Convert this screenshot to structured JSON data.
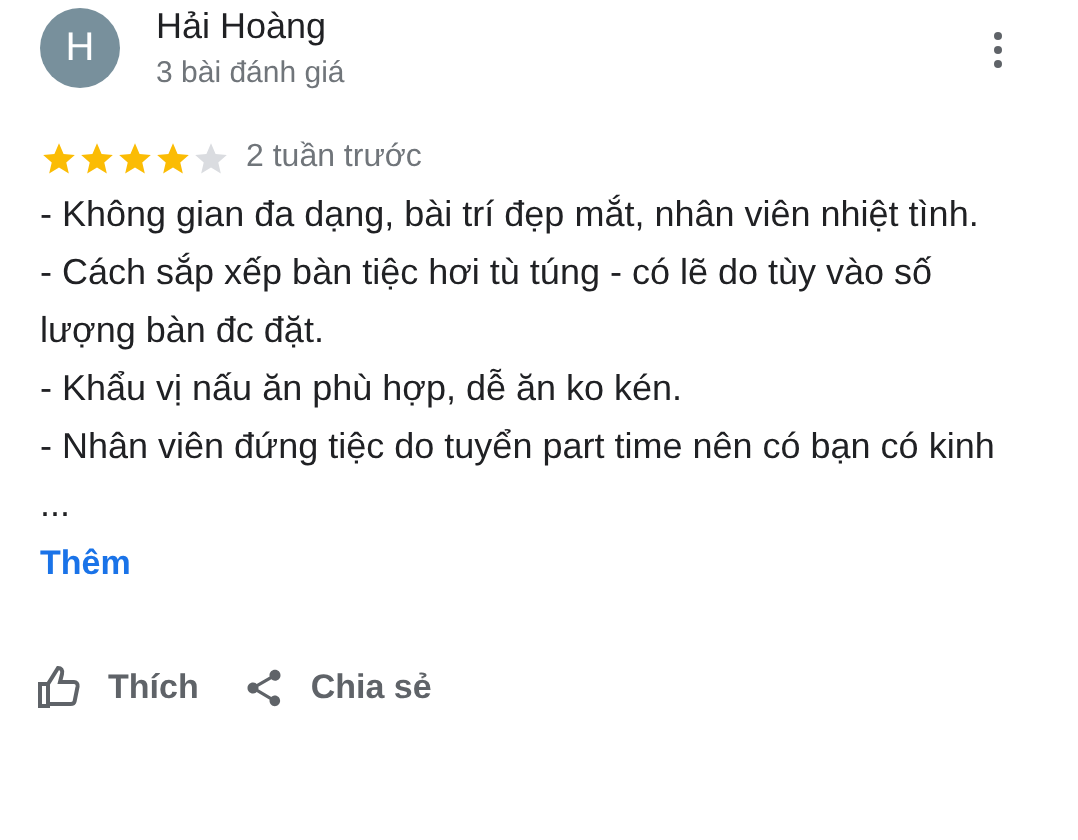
{
  "reviewer": {
    "initial": "H",
    "name": "Hải Hoàng",
    "review_count": "3 bài đánh giá"
  },
  "review": {
    "stars": 4,
    "time": "2 tuần trước",
    "lines": [
      "- Không gian đa dạng, bài trí đẹp mắt, nhân viên nhiệt tình.",
      "- Cách sắp xếp bàn tiệc hơi tù túng - có lẽ do tùy vào số lượng bàn đc đặt.",
      "- Khẩu vị nấu ăn phù hợp, dễ ăn ko kén.",
      "- Nhân viên đứng tiệc do tuyển part time nên có bạn có kinh ..."
    ],
    "more": "Thêm"
  },
  "actions": [
    {
      "kind": "like",
      "label": "Thích"
    },
    {
      "kind": "share",
      "label": "Chia sẻ"
    }
  ]
}
